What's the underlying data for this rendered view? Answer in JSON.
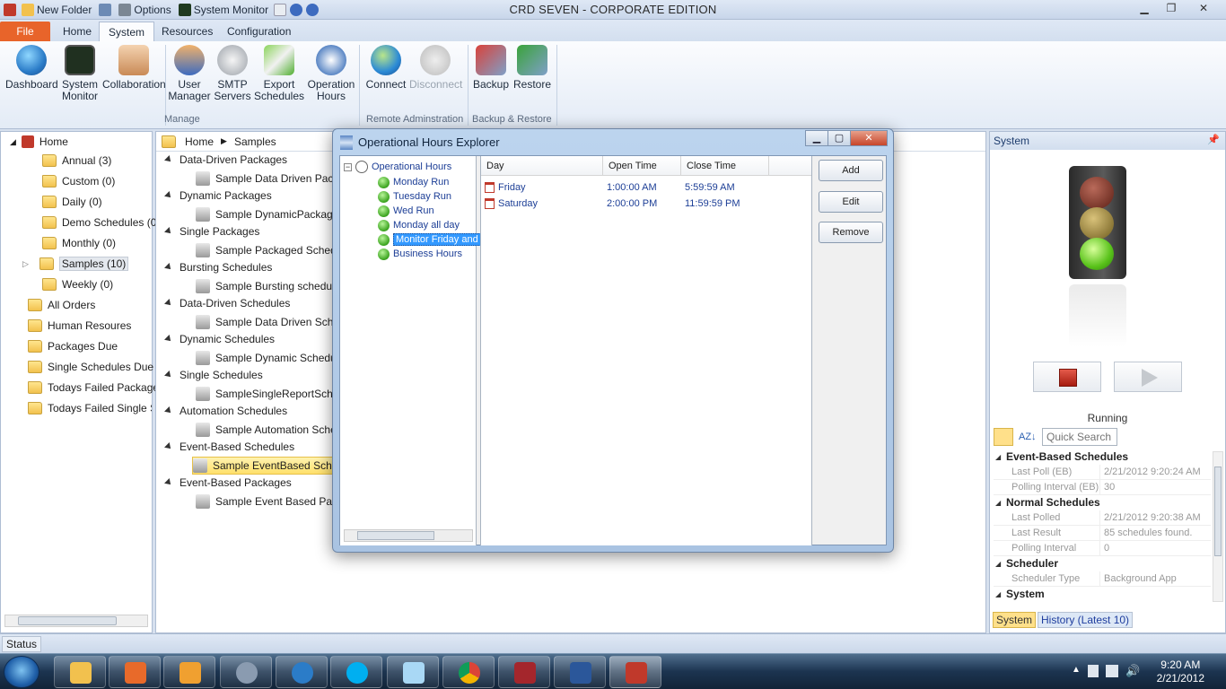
{
  "titlebar": {
    "app_title": "CRD SEVEN - CORPORATE EDITION",
    "qat_new_folder": "New Folder",
    "qat_options": "Options",
    "qat_system_monitor": "System Monitor"
  },
  "ribbon_tabs": {
    "file": "File",
    "home": "Home",
    "system": "System",
    "resources": "Resources",
    "configuration": "Configuration"
  },
  "ribbon": {
    "dashboard": "Dashboard",
    "system_monitor_1": "System",
    "system_monitor_2": "Monitor",
    "collaboration": "Collaboration",
    "user_manager_1": "User",
    "user_manager_2": "Manager",
    "smtp_1": "SMTP",
    "smtp_2": "Servers",
    "export_1": "Export",
    "export_2": "Schedules",
    "ophours_1": "Operation",
    "ophours_2": "Hours",
    "connect": "Connect",
    "disconnect": "Disconnect",
    "backup": "Backup",
    "restore": "Restore",
    "group_manage": "Manage",
    "group_remote": "Remote Adminstration",
    "group_backup": "Backup & Restore"
  },
  "left_tree": {
    "home": "Home",
    "annual": "Annual (3)",
    "custom": "Custom (0)",
    "daily": "Daily (0)",
    "demo": "Demo Schedules (0)",
    "monthly": "Monthly (0)",
    "samples": "Samples (10)",
    "weekly": "Weekly (0)",
    "all_orders": "All Orders",
    "human": "Human Resoures",
    "packages_due": "Packages Due",
    "single_due": "Single Schedules Due",
    "todays_failed_packages": "Todays Failed Packages",
    "todays_failed_single": "Todays Failed Single Sc"
  },
  "middle": {
    "crumb_home": "Home",
    "crumb_samples": "Samples",
    "groups": [
      {
        "label": "Data-Driven Packages",
        "item": "Sample Data Driven Packa"
      },
      {
        "label": "Dynamic Packages",
        "item": "Sample DynamicPackage"
      },
      {
        "label": "Single Packages",
        "item": "Sample Packaged Schedule"
      },
      {
        "label": "Bursting Schedules",
        "item": "Sample Bursting schedule"
      },
      {
        "label": "Data-Driven Schedules",
        "item": "Sample Data Driven Sched"
      },
      {
        "label": "Dynamic Schedules",
        "item": "Sample Dynamic Schedule"
      },
      {
        "label": "Single Schedules",
        "item": "SampleSingleReportSched"
      },
      {
        "label": "Automation Schedules",
        "item": "Sample Automation Sched"
      },
      {
        "label": "Event-Based Schedules",
        "item": "Sample EventBased Sched"
      },
      {
        "label": "Event-Based Packages",
        "item": "Sample Event Based Packa"
      }
    ]
  },
  "dialog": {
    "title": "Operational Hours Explorer",
    "tree_root": "Operational Hours",
    "nodes": [
      "Monday Run",
      "Tuesday Run",
      "Wed Run",
      "Monday all day",
      "Monitor Friday and",
      "Business Hours"
    ],
    "col_day": "Day",
    "col_open": "Open Time",
    "col_close": "Close Time",
    "rows": [
      {
        "day": "Friday",
        "open": "1:00:00 AM",
        "close": "5:59:59 AM"
      },
      {
        "day": "Saturday",
        "open": "2:00:00 PM",
        "close": "11:59:59 PM"
      }
    ],
    "add": "Add",
    "edit": "Edit",
    "remove": "Remove"
  },
  "system_pane": {
    "title": "System",
    "status": "Running",
    "quick_search": "Quick Search",
    "cat_event": "Event-Based Schedules",
    "last_poll_eb_k": "Last Poll (EB)",
    "last_poll_eb_v": "2/21/2012 9:20:24 AM",
    "poll_int_eb_k": "Polling Interval (EB)",
    "poll_int_eb_v": "30",
    "cat_normal": "Normal Schedules",
    "last_polled_k": "Last Polled",
    "last_polled_v": "2/21/2012 9:20:38 AM",
    "last_result_k": "Last Result",
    "last_result_v": "85 schedules found.",
    "poll_int_k": "Polling Interval",
    "poll_int_v": "0",
    "cat_scheduler": "Scheduler",
    "sched_type_k": "Scheduler Type",
    "sched_type_v": "Background App",
    "cat_system": "System",
    "tab_system": "System",
    "tab_history": "History (Latest 10)"
  },
  "statusbar": {
    "label": "Status"
  },
  "taskbar": {
    "time": "9:20 AM",
    "date": "2/21/2012"
  },
  "colors": {
    "file_tab": "#e8642a",
    "selection": "#3399ff",
    "tree_text": "#1c3e96"
  }
}
